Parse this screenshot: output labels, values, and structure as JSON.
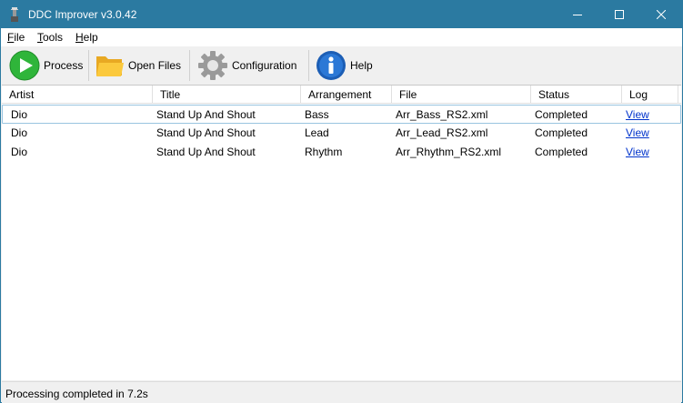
{
  "window": {
    "title": "DDC Improver v3.0.42",
    "accent": "#2b7aa1"
  },
  "menu": [
    {
      "label_u": "F",
      "label_rest": "ile"
    },
    {
      "label_u": "T",
      "label_rest": "ools"
    },
    {
      "label_u": "H",
      "label_rest": "elp"
    }
  ],
  "toolbar": {
    "process": "Process",
    "open_files": "Open Files",
    "configuration": "Configuration",
    "help": "Help"
  },
  "grid": {
    "columns": [
      "Artist",
      "Title",
      "Arrangement",
      "File",
      "Status",
      "Log"
    ],
    "rows": [
      {
        "artist": "Dio",
        "title": "Stand Up And Shout",
        "arrangement": "Bass",
        "file": "Arr_Bass_RS2.xml",
        "status": "Completed",
        "log": "View"
      },
      {
        "artist": "Dio",
        "title": "Stand Up And Shout",
        "arrangement": "Lead",
        "file": "Arr_Lead_RS2.xml",
        "status": "Completed",
        "log": "View"
      },
      {
        "artist": "Dio",
        "title": "Stand Up And Shout",
        "arrangement": "Rhythm",
        "file": "Arr_Rhythm_RS2.xml",
        "status": "Completed",
        "log": "View"
      }
    ]
  },
  "status": {
    "text": "Processing completed in 7.2s"
  }
}
